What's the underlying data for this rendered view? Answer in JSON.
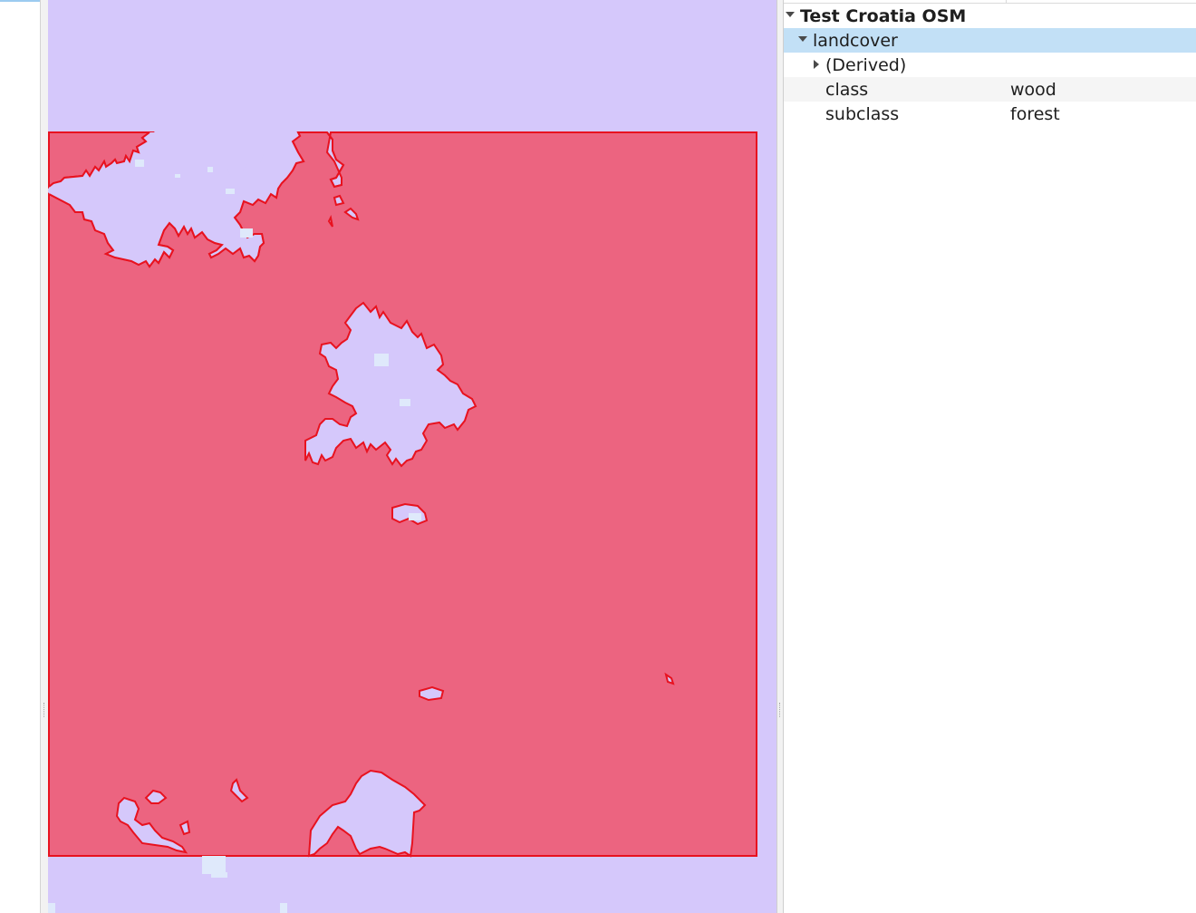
{
  "identify": {
    "root_label": "Test Croatia OSM",
    "layer_label": "landcover",
    "derived_label": "(Derived)",
    "attributes": [
      {
        "name": "class",
        "value": "wood"
      },
      {
        "name": "subclass",
        "value": "forest"
      }
    ]
  },
  "colors": {
    "map_background": "#d5c8fb",
    "feature_fill": "#ec6480",
    "feature_outline": "#e8121f",
    "hole_light": "#dfe9fb",
    "selected_row": "#c2e0f6"
  },
  "icons": {
    "expanded": "triangle-down",
    "collapsed": "triangle-right"
  }
}
